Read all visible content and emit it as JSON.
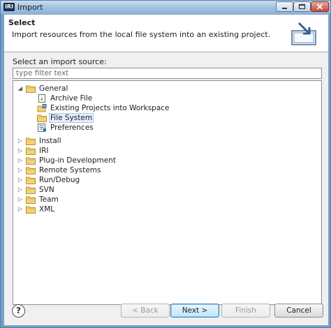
{
  "window": {
    "title": "Import",
    "app_icon": "IRI"
  },
  "header": {
    "title": "Select",
    "description": "Import resources from the local file system into an existing project."
  },
  "source_label": "Select an import source:",
  "filter": {
    "value": "",
    "placeholder": "type filter text"
  },
  "tree": {
    "general": {
      "label": "General",
      "children": [
        {
          "label": "Archive File",
          "icon": "archive-file-icon"
        },
        {
          "label": "Existing Projects into Workspace",
          "icon": "projects-icon"
        },
        {
          "label": "File System",
          "icon": "folder-icon",
          "selected": true
        },
        {
          "label": "Preferences",
          "icon": "preferences-icon"
        }
      ]
    },
    "categories": [
      {
        "label": "Install"
      },
      {
        "label": "IRI"
      },
      {
        "label": "Plug-in Development"
      },
      {
        "label": "Remote Systems"
      },
      {
        "label": "Run/Debug"
      },
      {
        "label": "SVN"
      },
      {
        "label": "Team"
      },
      {
        "label": "XML"
      }
    ]
  },
  "buttons": {
    "help": "?",
    "back": "< Back",
    "next": "Next >",
    "finish": "Finish",
    "cancel": "Cancel"
  },
  "colors": {
    "folder": "#e8c15a",
    "selection": "#e4efff",
    "default_button": "#3c7fb1"
  }
}
